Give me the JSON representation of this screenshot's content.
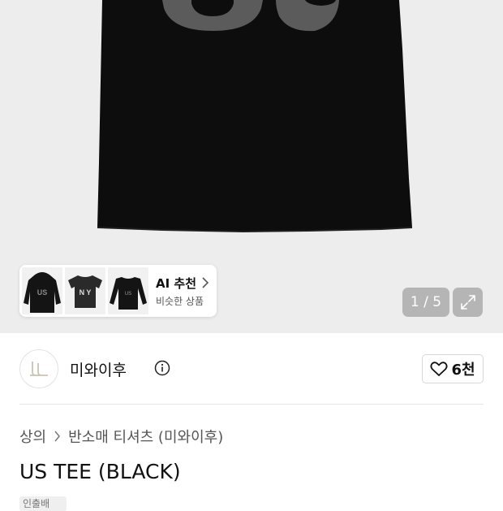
{
  "gallery": {
    "shirt_print": "US",
    "thumbnails": [
      {
        "print": "US"
      },
      {
        "print": "N Y"
      },
      {
        "print": "US"
      }
    ],
    "ai_recommend": {
      "title": "AI 추천",
      "subtitle": "비슷한 상품"
    },
    "counter": "1 / 5"
  },
  "brand": {
    "name": "미와이후",
    "likes": "6천"
  },
  "breadcrumb": {
    "category": "상의",
    "subcategory": "반소매 티셔츠 (미와이후)"
  },
  "product": {
    "title": "US TEE (BLACK)",
    "tag": "인출배"
  },
  "colors": {
    "shirt": "#0d0d0d",
    "print": "#5b5b5b",
    "hero_bg": "#ededed"
  }
}
